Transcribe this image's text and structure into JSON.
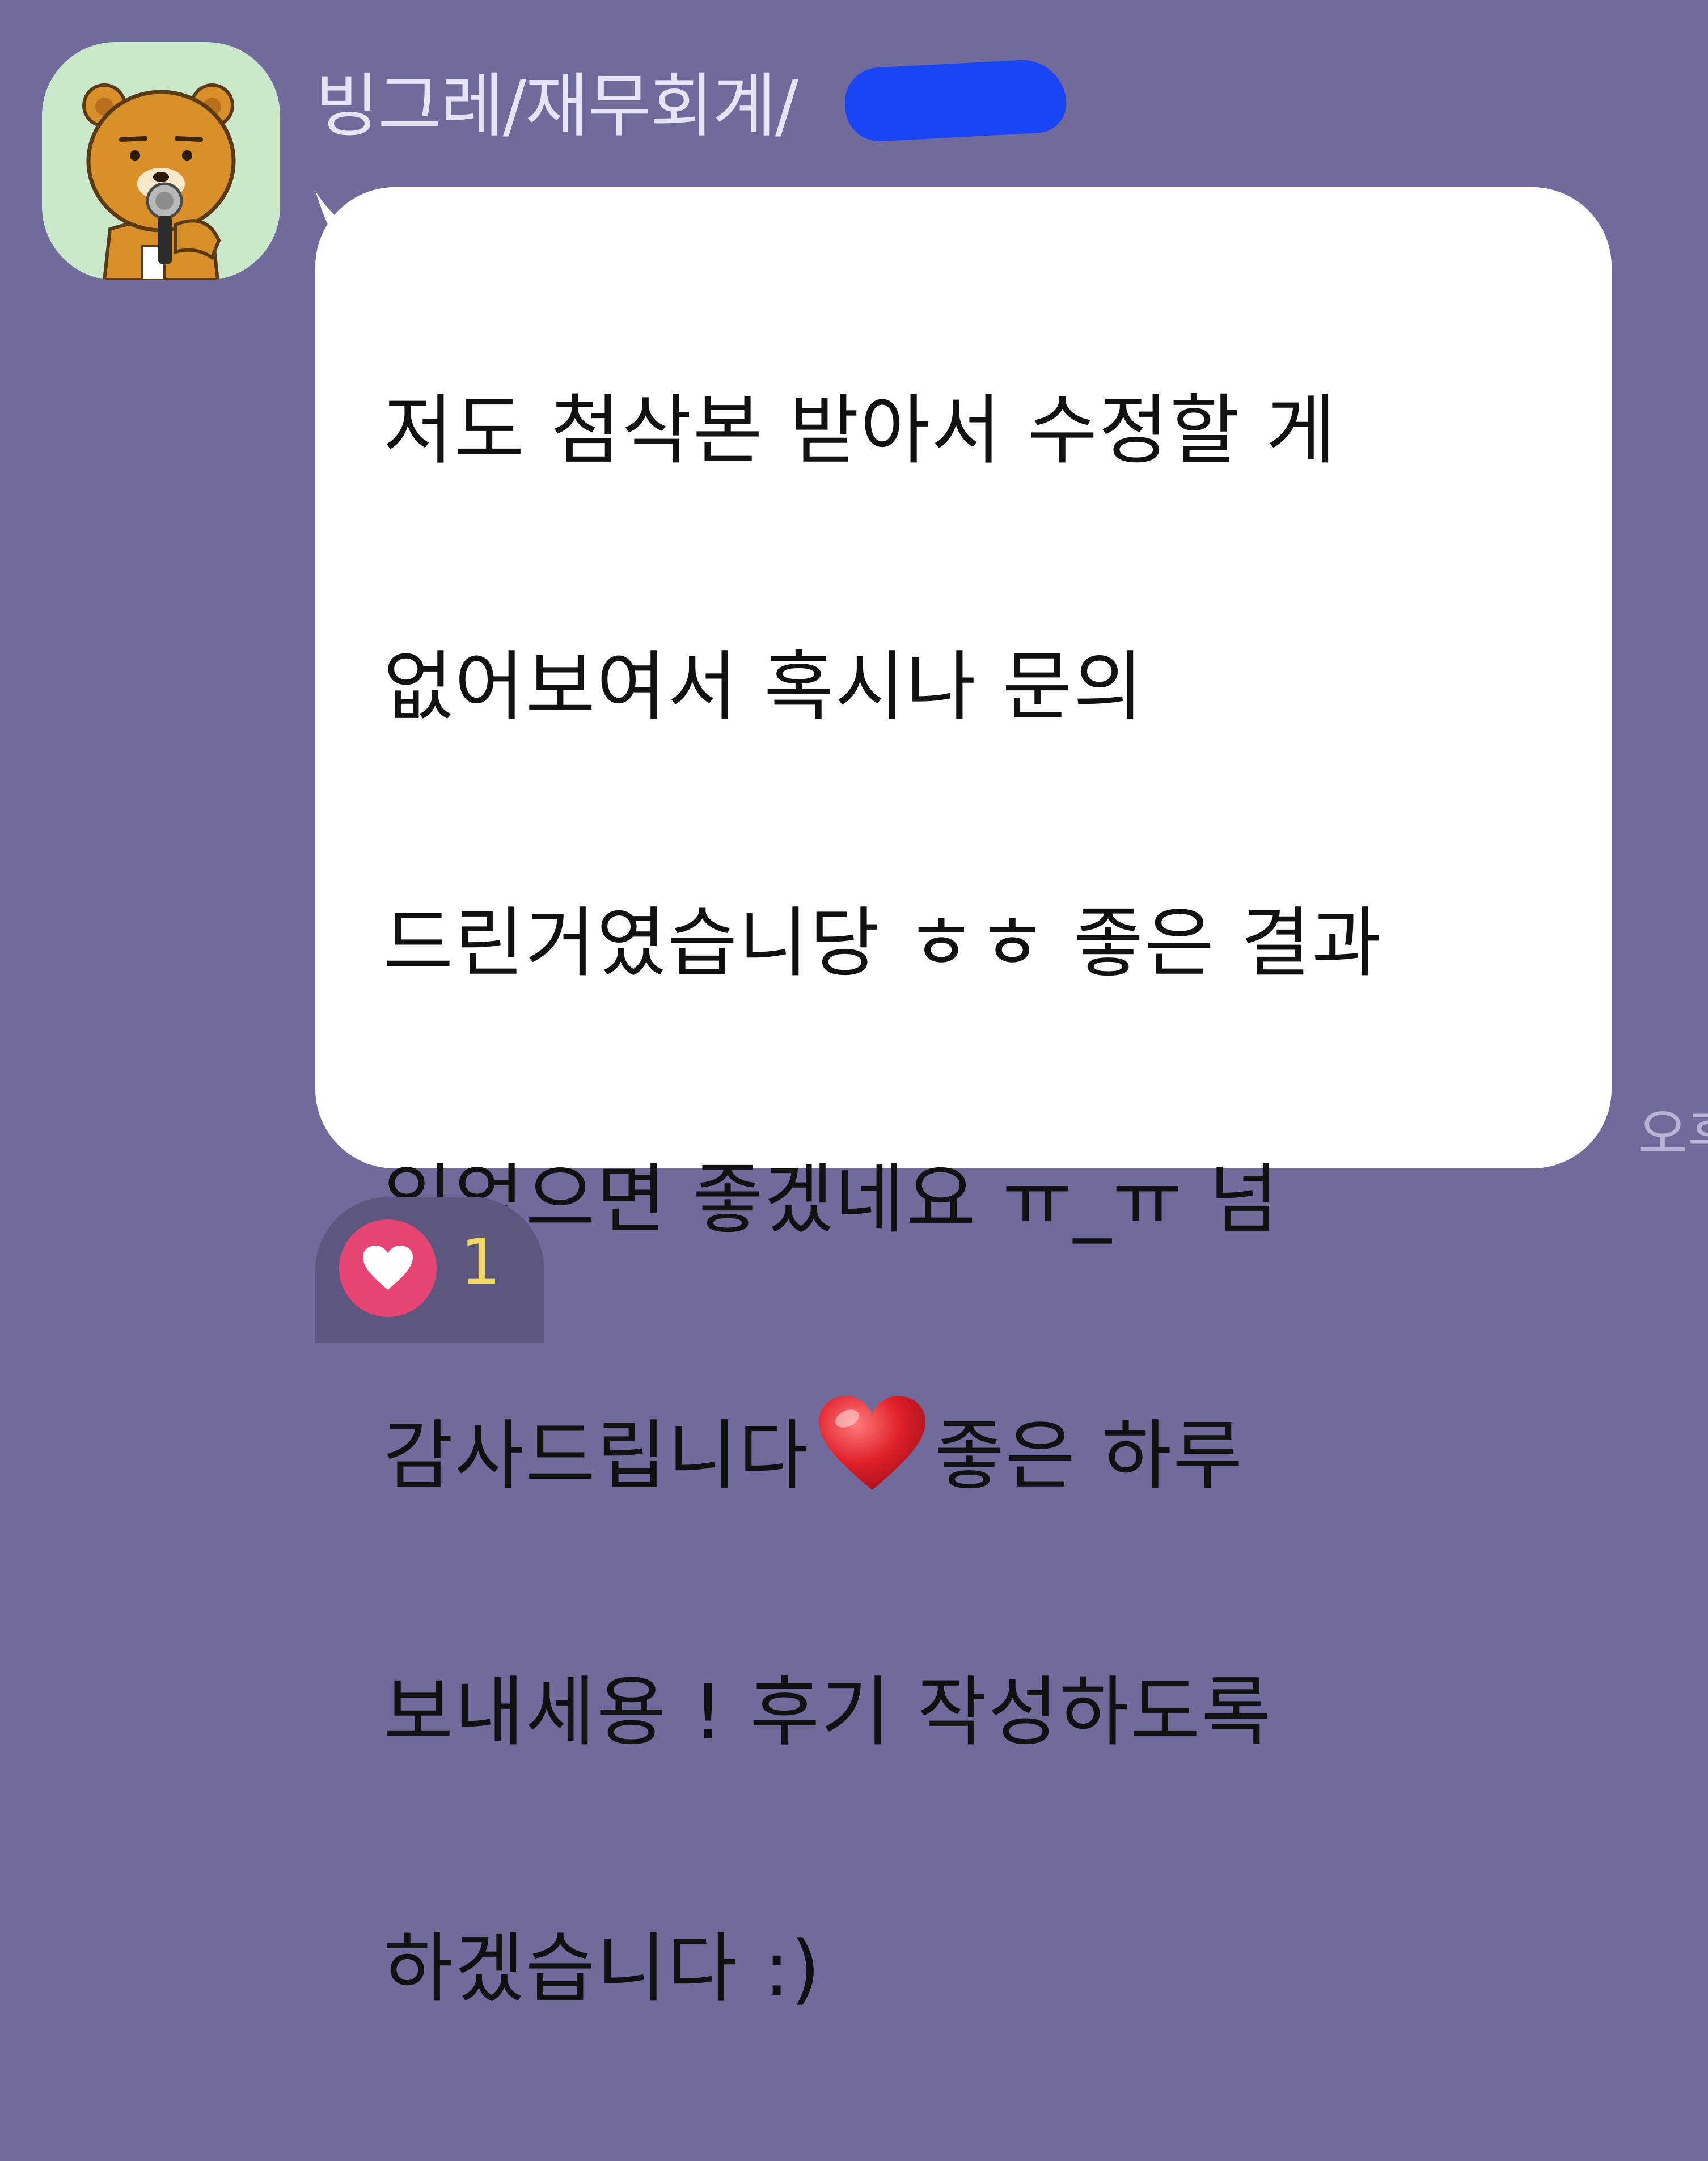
{
  "colors": {
    "background": "#716a9d",
    "bubble": "#ffffff",
    "reaction_icon": "#e74574",
    "reaction_count": "#f2d863"
  },
  "sender": {
    "name": "빙그레/재무회계/",
    "avatar_icon": "bear-character-avatar-icon"
  },
  "message": {
    "lines": [
      "저도 첨삭본 받아서 수정할 게",
      "없어보여서 혹시나 문의",
      "드린거였습니당 ㅎㅎ 좋은 결과",
      "있었으면 좋겠네요 ㅠ_ㅠ 넘",
      "감사드립니다",
      "좋은 하루",
      "보내세용 ! 후기 작성하도록",
      "하겠습니다 :)"
    ],
    "emoji": "red-heart-icon"
  },
  "timestamp": "오후",
  "reaction": {
    "icon": "heart-icon",
    "count": "1"
  }
}
